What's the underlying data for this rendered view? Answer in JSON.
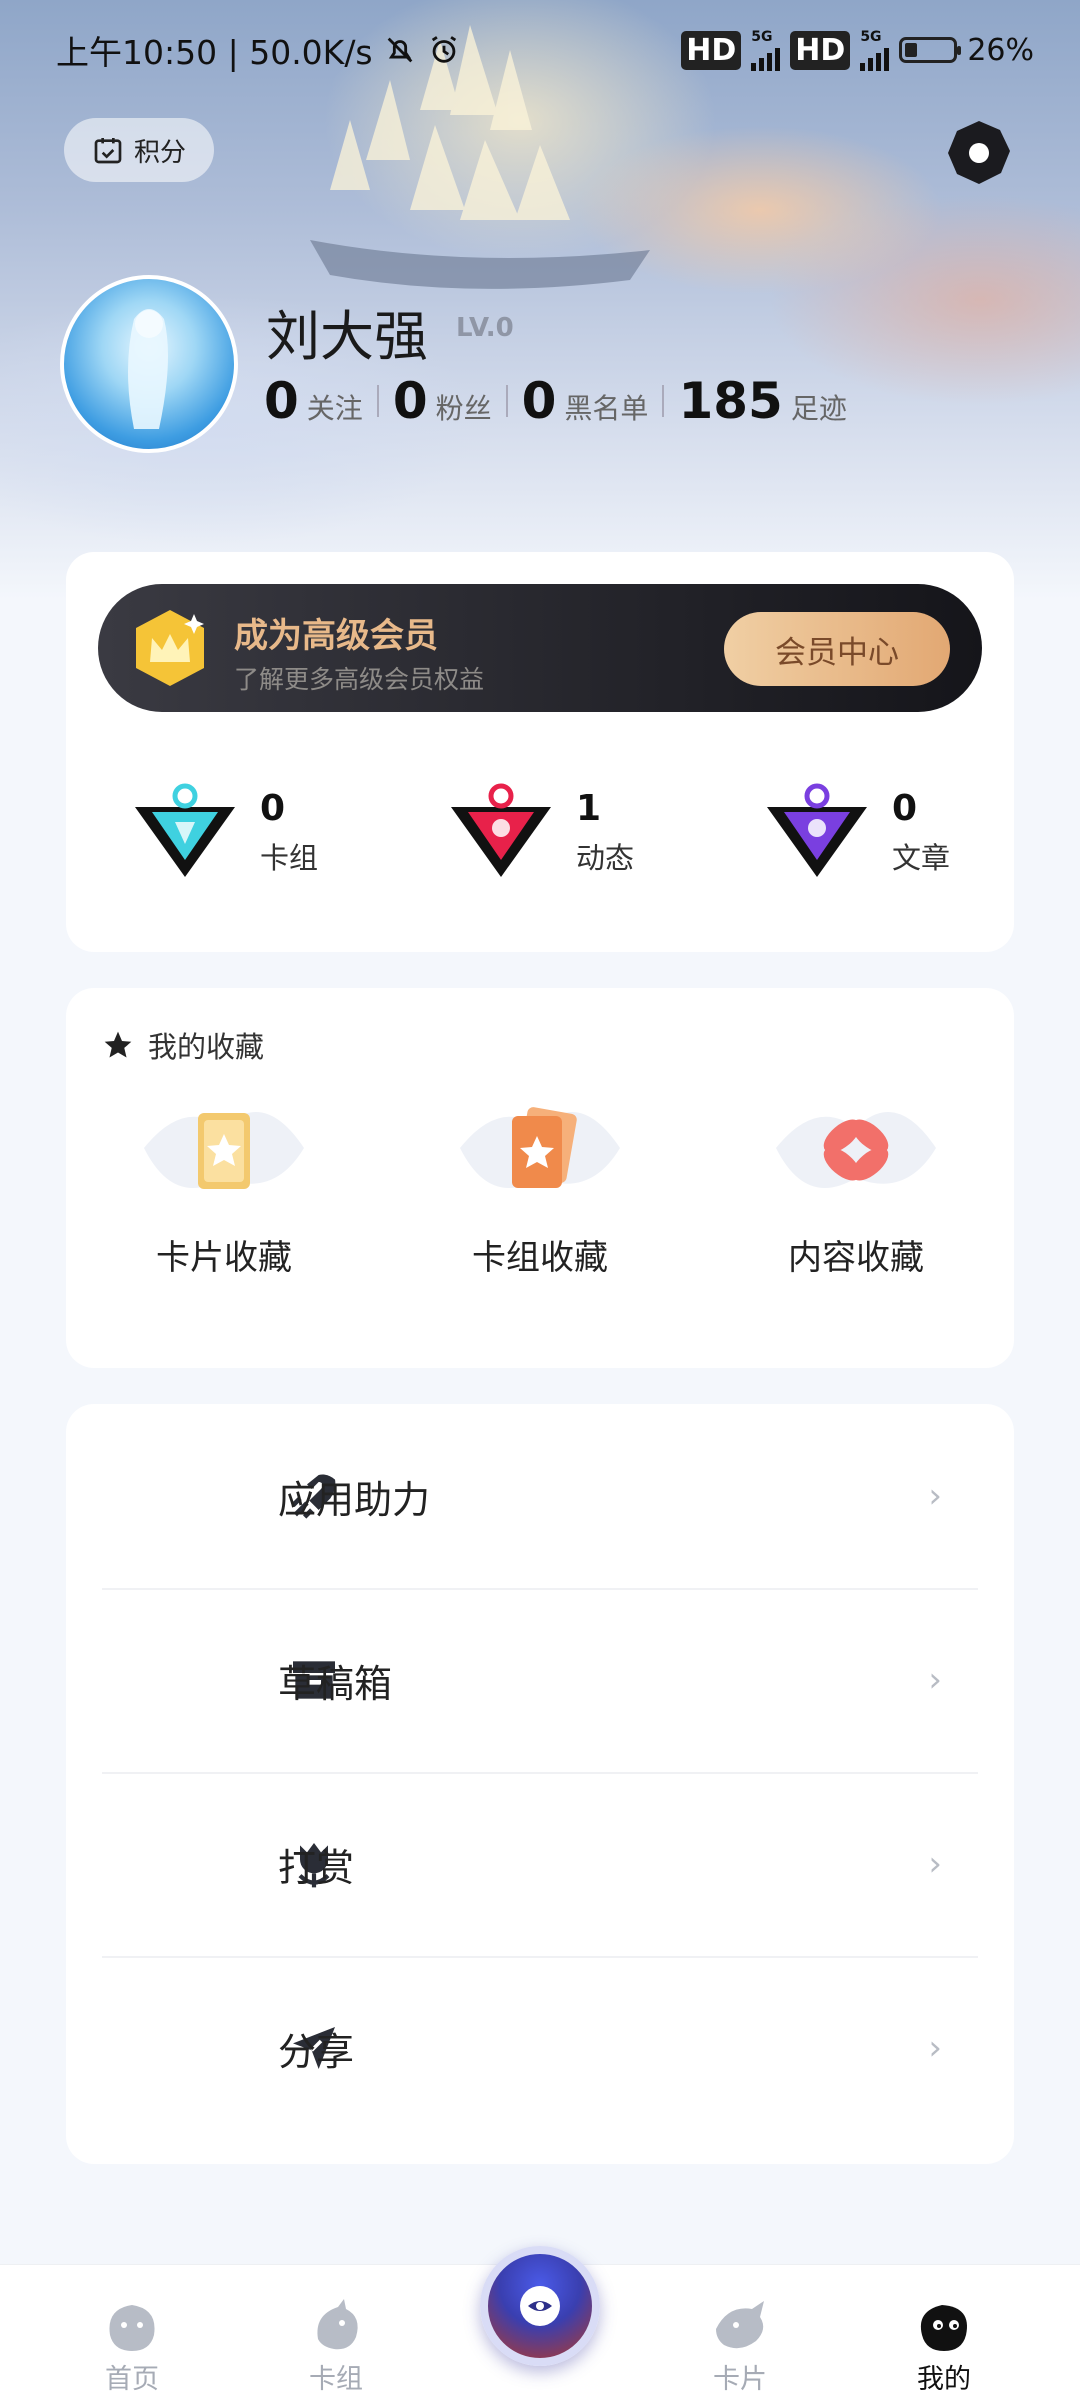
{
  "status_bar": {
    "time_speed": "上午10:50 | 50.0K/s",
    "hd1": "HD",
    "net1": "5G",
    "hd2": "HD",
    "net2": "5G",
    "battery": "26%"
  },
  "header": {
    "points_label": "积分",
    "settings_icon": "settings-icon"
  },
  "profile": {
    "name": "刘大强",
    "level": "LV.0",
    "stats": [
      {
        "value": "0",
        "label": "关注"
      },
      {
        "value": "0",
        "label": "粉丝"
      },
      {
        "value": "0",
        "label": "黑名单"
      },
      {
        "value": "185",
        "label": "足迹"
      }
    ]
  },
  "vip": {
    "title": "成为高级会员",
    "subtitle": "了解更多高级会员权益",
    "button": "会员中心"
  },
  "counts": [
    {
      "value": "0",
      "label": "卡组",
      "color": "#3fd1e0"
    },
    {
      "value": "1",
      "label": "动态",
      "color": "#e8214a"
    },
    {
      "value": "0",
      "label": "文章",
      "color": "#7a3fe0"
    }
  ],
  "favorites": {
    "title": "我的收藏",
    "items": [
      {
        "label": "卡片收藏"
      },
      {
        "label": "卡组收藏"
      },
      {
        "label": "内容收藏"
      }
    ]
  },
  "menu": [
    {
      "label": "应用助力",
      "icon": "rocket-icon"
    },
    {
      "label": "草稿箱",
      "icon": "archive-box-icon"
    },
    {
      "label": "打赏",
      "icon": "tulip-icon"
    },
    {
      "label": "分享",
      "icon": "paper-plane-icon"
    }
  ],
  "bottom_nav": [
    {
      "label": "首页"
    },
    {
      "label": "卡组"
    },
    {
      "label": "卡片"
    },
    {
      "label": "我的"
    }
  ]
}
